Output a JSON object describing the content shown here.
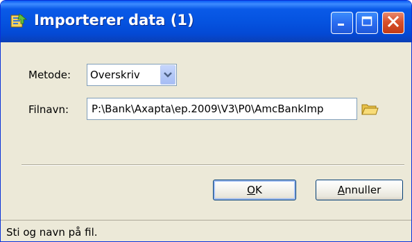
{
  "window": {
    "title": "Importerer data (1)"
  },
  "form": {
    "method_label": "Metode:",
    "method_value": "Overskriv",
    "filename_label": "Filnavn:",
    "filename_value": "P:\\Bank\\Axapta\\ep.2009\\V3\\P0\\AmcBankImp"
  },
  "buttons": {
    "ok_label": "OK",
    "cancel_label": "Annuller"
  },
  "status": {
    "text": "Sti og navn på fil."
  },
  "icons": {
    "app": "app-icon",
    "minimize": "minimize-icon",
    "maximize": "maximize-icon",
    "close": "close-icon",
    "dropdown": "chevron-down-icon",
    "folder": "folder-icon"
  },
  "colors": {
    "titlebar": "#0553e0",
    "close_button": "#d8502c",
    "dialog_bg": "#ece9d8"
  }
}
